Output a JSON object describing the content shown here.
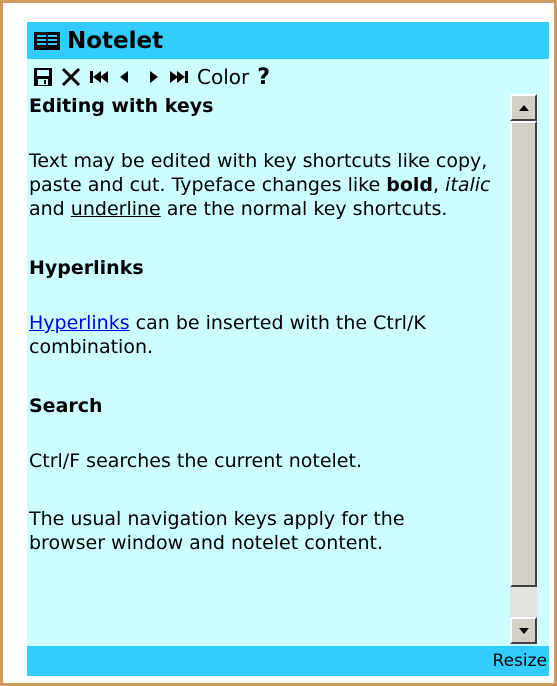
{
  "notelet": {
    "title": "Notelet",
    "toolbar": {
      "color_label": "Color",
      "help_label": "?"
    },
    "content": {
      "section1": {
        "heading": "Editing with keys",
        "text_a": "Text may be edited with key shortcuts like copy, paste and cut. Typeface changes like ",
        "bold_word": "bold",
        "sep1": ", ",
        "italic_word": "italic",
        "sep2": " and ",
        "underline_word": "underline",
        "text_b": " are the normal key shortcuts."
      },
      "section2": {
        "heading": "Hyperlinks",
        "link_text": "Hyperlinks",
        "text": " can be inserted with the Ctrl/K combination."
      },
      "section3": {
        "heading": "Search",
        "text": "Ctrl/F searches the current notelet."
      },
      "trailing_text": "The usual navigation keys apply for the",
      "trailing_text_cut": "browser window and notelet content."
    },
    "status": {
      "resize_label": "Resize"
    }
  },
  "colors": {
    "title_bar": "#33ccff",
    "panel_background": "#ccffff",
    "frame_border": "#cf9a5c",
    "link": "#0000ee"
  }
}
